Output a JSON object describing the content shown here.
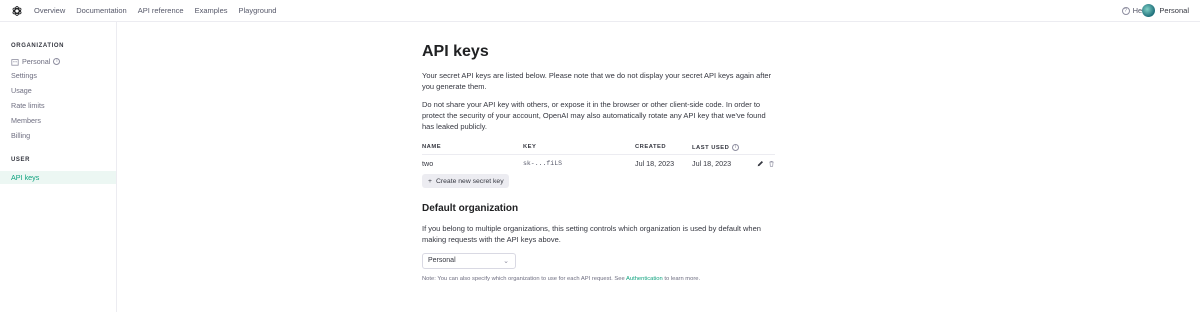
{
  "nav": {
    "links": [
      "Overview",
      "Documentation",
      "API reference",
      "Examples",
      "Playground"
    ],
    "help_label": "Help",
    "account_label": "Personal"
  },
  "sidebar": {
    "org_heading": "ORGANIZATION",
    "org_name": "Personal",
    "org_items": [
      "Settings",
      "Usage",
      "Rate limits",
      "Members",
      "Billing"
    ],
    "user_heading": "USER",
    "active_item": "API keys"
  },
  "main": {
    "title": "API keys",
    "para1": "Your secret API keys are listed below. Please note that we do not display your secret API keys again after you generate them.",
    "para2": "Do not share your API key with others, or expose it in the browser or other client-side code. In order to protect the security of your account, OpenAI may also automatically rotate any API key that we've found has leaked publicly.",
    "table": {
      "headers": {
        "name": "NAME",
        "key": "KEY",
        "created": "CREATED",
        "last_used": "LAST USED"
      },
      "rows": [
        {
          "name": "two",
          "key": "sk-...fiLS",
          "created": "Jul 18, 2023",
          "last_used": "Jul 18, 2023"
        }
      ]
    },
    "create_button": "Create new secret key",
    "default_org_title": "Default organization",
    "default_org_para": "If you belong to multiple organizations, this setting controls which organization is used by default when making requests with the API keys above.",
    "select_value": "Personal",
    "note_prefix": "Note: You can also specify which organization to use for each API request. See ",
    "note_link": "Authentication",
    "note_suffix": " to learn more."
  },
  "colors": {
    "accent": "#10a37f",
    "text": "#353740",
    "border": "#ececf1"
  },
  "icons": [
    "openai-logo-icon",
    "help-icon",
    "avatar",
    "building-icon",
    "info-icon",
    "edit-icon",
    "trash-icon",
    "plus-icon",
    "chevron-down-icon"
  ]
}
